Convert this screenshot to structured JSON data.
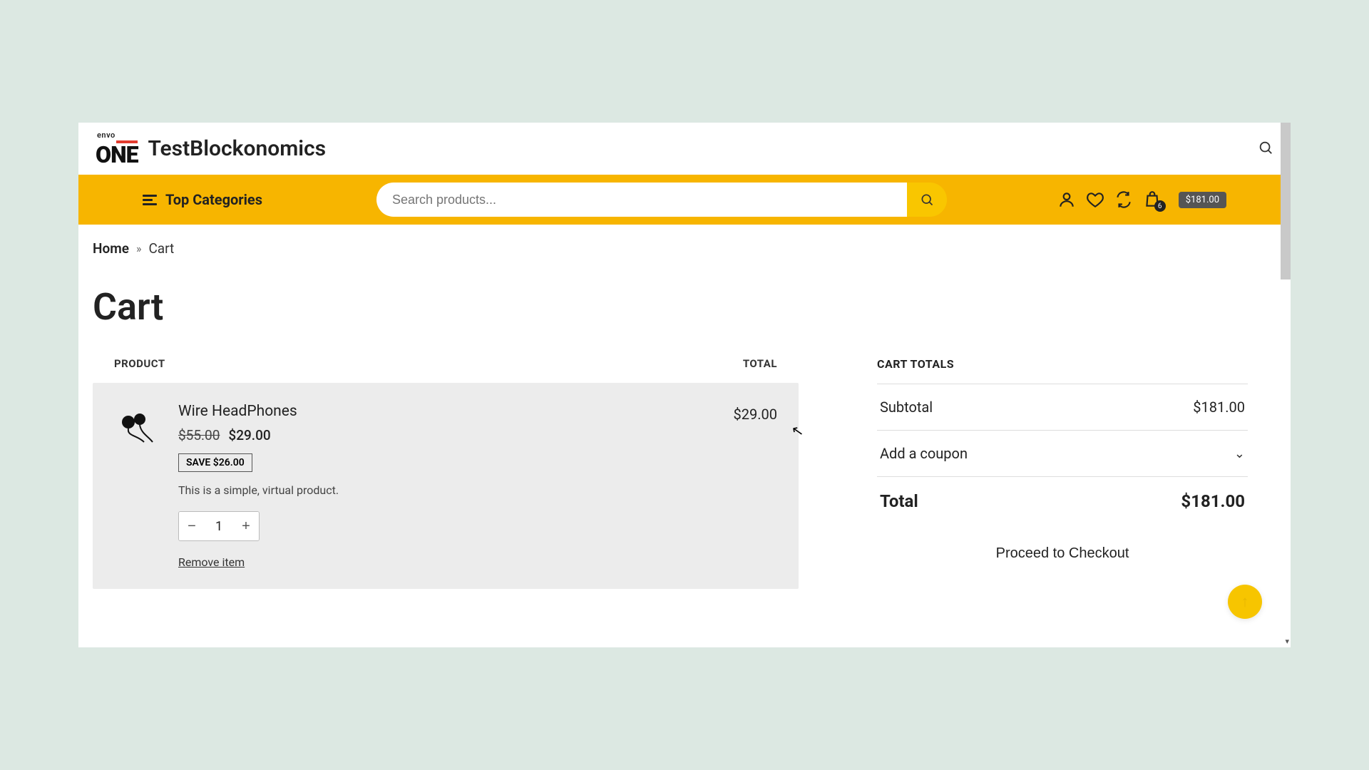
{
  "header": {
    "logo_small": "envo",
    "logo_big": "ONE",
    "site_title": "TestBlockonomics"
  },
  "nav": {
    "top_categories": "Top Categories",
    "search_placeholder": "Search products...",
    "cart_count": "6",
    "cart_total": "$181.00"
  },
  "breadcrumb": {
    "home": "Home",
    "current": "Cart"
  },
  "page": {
    "title": "Cart"
  },
  "table": {
    "col_product": "PRODUCT",
    "col_total": "TOTAL"
  },
  "item": {
    "name": "Wire HeadPhones",
    "price_old": "$55.00",
    "price_new": "$29.00",
    "save_badge": "SAVE $26.00",
    "description": "This is a simple, virtual product.",
    "qty_minus": "−",
    "qty_value": "1",
    "qty_plus": "+",
    "remove": "Remove item",
    "line_total": "$29.00"
  },
  "totals": {
    "title": "CART TOTALS",
    "subtotal_label": "Subtotal",
    "subtotal_value": "$181.00",
    "coupon_label": "Add a coupon",
    "total_label": "Total",
    "total_value": "$181.00",
    "checkout": "Proceed to Checkout"
  }
}
